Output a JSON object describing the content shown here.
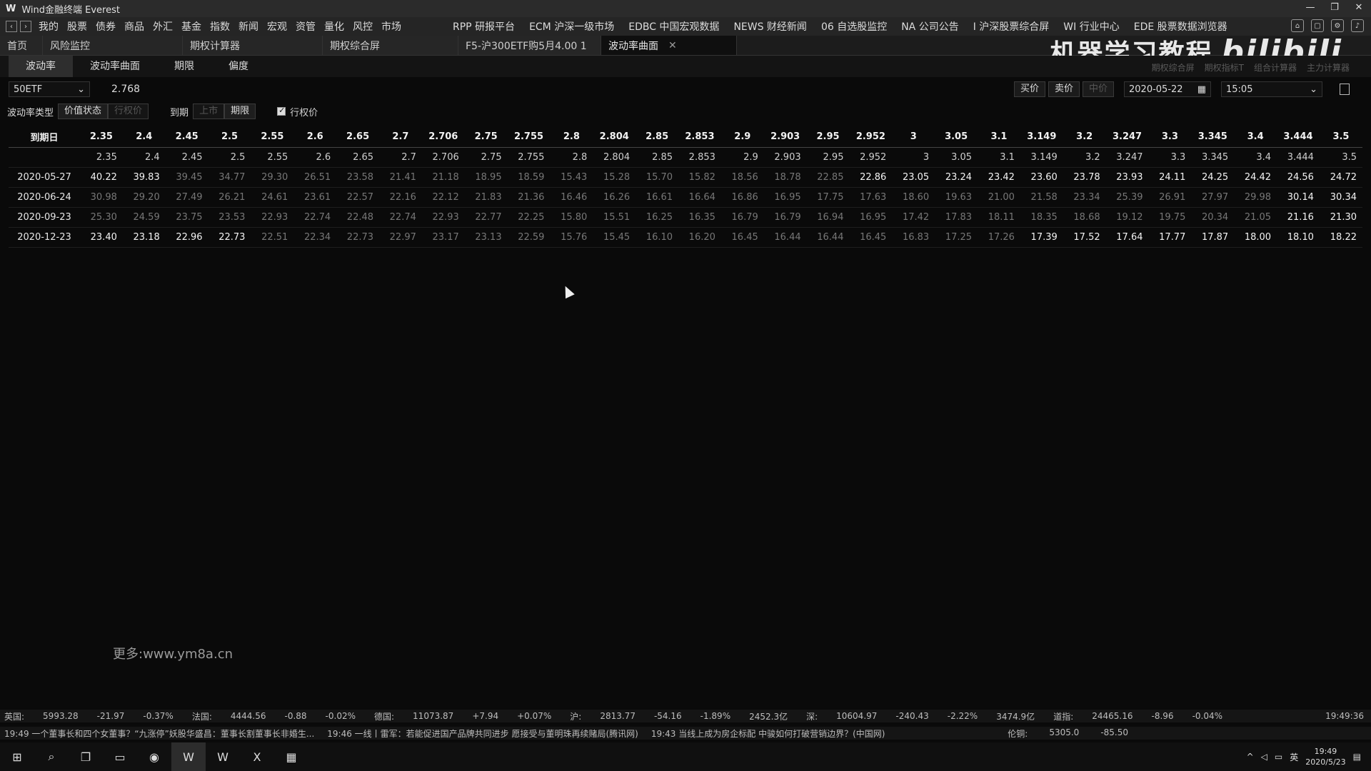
{
  "window": {
    "app_icon": "W",
    "title": "Wind金融终端 Everest",
    "controls": [
      "—",
      "❐",
      "✕"
    ]
  },
  "menubar": {
    "left_items": [
      "我的",
      "股票",
      "债券",
      "商品",
      "外汇",
      "基金",
      "指数",
      "新闻",
      "宏观",
      "资管",
      "量化",
      "风控",
      "市场"
    ],
    "right_items": [
      "RPP 研报平台",
      "ECM 沪深一级市场",
      "EDBC 中国宏观数据",
      "NEWS 财经新闻",
      "06 自选股监控",
      "NA 公司公告",
      "I 沪深股票综合屏",
      "WI 行业中心",
      "EDE 股票数据浏览器"
    ]
  },
  "tabs": [
    {
      "label": "首页"
    },
    {
      "label": "风险监控"
    },
    {
      "label": "期权计算器"
    },
    {
      "label": "期权综合屏"
    },
    {
      "label": "F5-沪300ETF购5月4.00 1"
    },
    {
      "label": "波动率曲面",
      "active": true
    }
  ],
  "overlay_watermark": {
    "text": "机器学习教程",
    "brand": "bilibili"
  },
  "subtabs": [
    "波动率",
    "波动率曲面",
    "期限",
    "偏度"
  ],
  "faint_links": [
    "期权综合屏",
    "期权指标T",
    "组合计算器",
    "主力计算器"
  ],
  "controls": {
    "underlying": "50ETF",
    "price": "2.768",
    "buy_label": "买价",
    "sell_label": "卖价",
    "mid_label": "中价",
    "date": "2020-05-22",
    "time": "15:05"
  },
  "options": {
    "vol_type_label": "波动率类型",
    "vol_type_options": [
      "价值状态",
      "行权价"
    ],
    "expiry_label": "到期",
    "expiry_options": [
      "上市",
      "期限"
    ],
    "strike_checkbox_label": "行权价"
  },
  "grid": {
    "date_header": "到期日",
    "strikes": [
      "2.35",
      "2.4",
      "2.45",
      "2.5",
      "2.55",
      "2.6",
      "2.65",
      "2.7",
      "2.706",
      "2.75",
      "2.755",
      "2.8",
      "2.804",
      "2.85",
      "2.853",
      "2.9",
      "2.903",
      "2.95",
      "2.952",
      "3",
      "3.05",
      "3.1",
      "3.149",
      "3.2",
      "3.247",
      "3.3",
      "3.345",
      "3.4",
      "3.444",
      "3.5"
    ],
    "rows": [
      {
        "date": "2020-05-27",
        "values": [
          "40.22",
          "39.83",
          "39.45",
          "34.77",
          "29.30",
          "26.51",
          "23.58",
          "21.41",
          "21.18",
          "18.95",
          "18.59",
          "15.43",
          "15.28",
          "15.70",
          "15.82",
          "18.56",
          "18.78",
          "22.85",
          "22.86",
          "23.05",
          "23.24",
          "23.42",
          "23.60",
          "23.78",
          "23.93",
          "24.11",
          "24.25",
          "24.42",
          "24.56",
          "24.72"
        ]
      },
      {
        "date": "2020-06-24",
        "values": [
          "30.98",
          "29.20",
          "27.49",
          "26.21",
          "24.61",
          "23.61",
          "22.57",
          "22.16",
          "22.12",
          "21.83",
          "21.36",
          "16.46",
          "16.26",
          "16.61",
          "16.64",
          "16.86",
          "16.95",
          "17.75",
          "17.63",
          "18.60",
          "19.63",
          "21.00",
          "21.58",
          "23.34",
          "25.39",
          "26.91",
          "27.97",
          "29.98",
          "30.14",
          "30.34"
        ]
      },
      {
        "date": "2020-09-23",
        "values": [
          "25.30",
          "24.59",
          "23.75",
          "23.53",
          "22.93",
          "22.74",
          "22.48",
          "22.74",
          "22.93",
          "22.77",
          "22.25",
          "15.80",
          "15.51",
          "16.25",
          "16.35",
          "16.79",
          "16.79",
          "16.94",
          "16.95",
          "17.42",
          "17.83",
          "18.11",
          "18.35",
          "18.68",
          "19.12",
          "19.75",
          "20.34",
          "21.05",
          "21.16",
          "21.30"
        ]
      },
      {
        "date": "2020-12-23",
        "values": [
          "23.40",
          "23.18",
          "22.96",
          "22.73",
          "22.51",
          "22.34",
          "22.73",
          "22.97",
          "23.17",
          "23.13",
          "22.59",
          "15.76",
          "15.45",
          "16.10",
          "16.20",
          "16.45",
          "16.44",
          "16.44",
          "16.45",
          "16.83",
          "17.25",
          "17.26",
          "17.39",
          "17.52",
          "17.64",
          "17.77",
          "17.87",
          "18.00",
          "18.10",
          "18.22"
        ]
      }
    ]
  },
  "site_watermark": "更多:www.ym8a.cn",
  "ticker": [
    {
      "name": "英国:",
      "value": "5993.28",
      "chg": "-21.97",
      "pct": "-0.37%"
    },
    {
      "name": "法国:",
      "value": "4444.56",
      "chg": "-0.88",
      "pct": "-0.02%"
    },
    {
      "name": "德国:",
      "value": "11073.87",
      "chg": "+7.94",
      "pct": "+0.07%"
    },
    {
      "name": "沪:",
      "value": "2813.77",
      "chg": "-54.16",
      "pct": "-1.89%",
      "extra": "2452.3亿"
    },
    {
      "name": "深:",
      "value": "10604.97",
      "chg": "-240.43",
      "pct": "-2.22%",
      "extra": "3474.9亿"
    },
    {
      "name": "道指:",
      "value": "24465.16",
      "chg": "-8.96",
      "pct": "-0.04%"
    }
  ],
  "ticker_clock": "19:49:36",
  "news": [
    "19:49 一个董事长和四个女董事？“九涨停”妖股华盛昌：董事长割董事长非婚生...",
    "19:46 一线丨雷军：若能促进国产品牌共同进步 愿接受与董明珠再续赌局(腾讯网)",
    "19:43 当线上成为房企标配 中骏如何打破营销边界？(中国网)"
  ],
  "news_right": {
    "label": "伦铜:",
    "value": "5305.0",
    "chg": "-85.50"
  },
  "taskbar": {
    "apps": [
      "⊞",
      "⌕",
      "❐",
      "▭",
      "◉",
      "W",
      "W",
      "X",
      "▦"
    ],
    "tray_lang": "英",
    "time": "19:49",
    "date": "2020/5/23"
  }
}
